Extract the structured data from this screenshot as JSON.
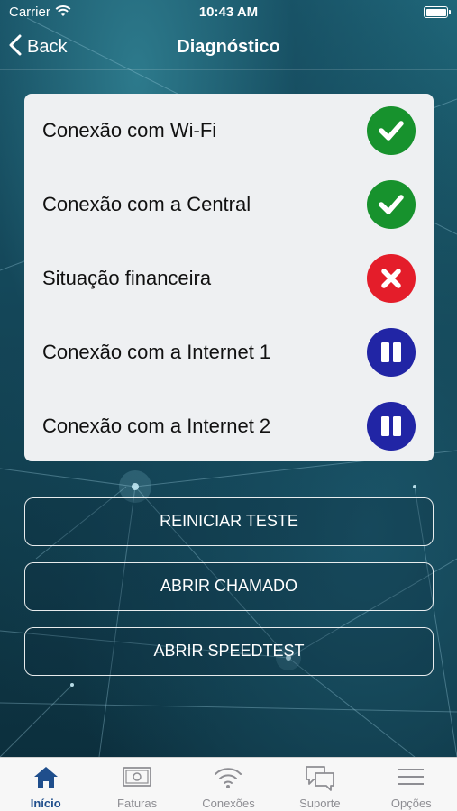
{
  "status_bar": {
    "carrier": "Carrier",
    "time": "10:43 AM"
  },
  "nav": {
    "back_label": "Back",
    "title": "Diagnóstico"
  },
  "checks": [
    {
      "label": "Conexão com Wi-Fi",
      "status": "ok",
      "icon": "check-icon"
    },
    {
      "label": "Conexão com a Central",
      "status": "ok",
      "icon": "check-icon"
    },
    {
      "label": "Situação financeira",
      "status": "fail",
      "icon": "x-icon"
    },
    {
      "label": "Conexão com a Internet 1",
      "status": "pending",
      "icon": "pause-icon"
    },
    {
      "label": "Conexão com a Internet 2",
      "status": "pending",
      "icon": "pause-icon"
    }
  ],
  "buttons": {
    "restart": "REINICIAR TESTE",
    "ticket": "ABRIR CHAMADO",
    "speedtest": "ABRIR SPEEDTEST"
  },
  "tabs": [
    {
      "label": "Início",
      "icon": "home-icon",
      "active": true
    },
    {
      "label": "Faturas",
      "icon": "bill-icon",
      "active": false
    },
    {
      "label": "Conexões",
      "icon": "wifi-icon",
      "active": false
    },
    {
      "label": "Suporte",
      "icon": "chat-icon",
      "active": false
    },
    {
      "label": "Opções",
      "icon": "menu-icon",
      "active": false
    }
  ],
  "colors": {
    "ok": "#17922d",
    "fail": "#e41d2a",
    "pending": "#2125a5",
    "active_tab": "#1f4e8c"
  }
}
